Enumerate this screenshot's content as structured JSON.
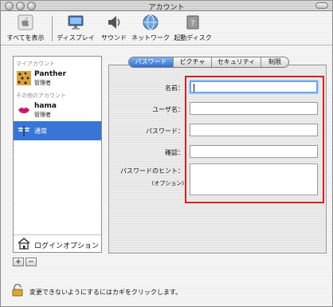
{
  "window": {
    "title": "アカウント"
  },
  "toolbar": {
    "show_all": "すべてを表示",
    "display": "ディスプレイ",
    "sound": "サウンド",
    "network": "ネットワーク",
    "startup_disk": "起動ディスク"
  },
  "accounts": {
    "my_account_header": "マイアカウント",
    "other_accounts_header": "その他のアカウント",
    "items": [
      {
        "name": "Panther",
        "role": "管理者",
        "avatar": "leopard-icon"
      },
      {
        "name": "hama",
        "role": "管理者",
        "avatar": "lips-icon"
      },
      {
        "name": "通常",
        "role": "",
        "avatar": "dragonfly-icon",
        "selected": true
      }
    ],
    "login_options": "ログインオプション",
    "add_label": "+",
    "remove_label": "−"
  },
  "tabs": [
    {
      "label": "パスワード",
      "active": true
    },
    {
      "label": "ピクチャ",
      "active": false
    },
    {
      "label": "セキュリティ",
      "active": false
    },
    {
      "label": "制限",
      "active": false
    }
  ],
  "form": {
    "name_label": "名前：",
    "username_label": "ユーザ名：",
    "password_label": "パスワード：",
    "confirm_label": "確認：",
    "hint_label": "パスワードのヒント：",
    "hint_optional": "(オプション)",
    "name_value": "",
    "username_value": "",
    "password_value": "",
    "confirm_value": "",
    "hint_value": ""
  },
  "lock": {
    "text": "変更できないようにするにはカギをクリックします。"
  },
  "colors": {
    "selection": "#3875d7",
    "highlight_border": "#d62020",
    "tab_active": "#2f6ed0"
  }
}
